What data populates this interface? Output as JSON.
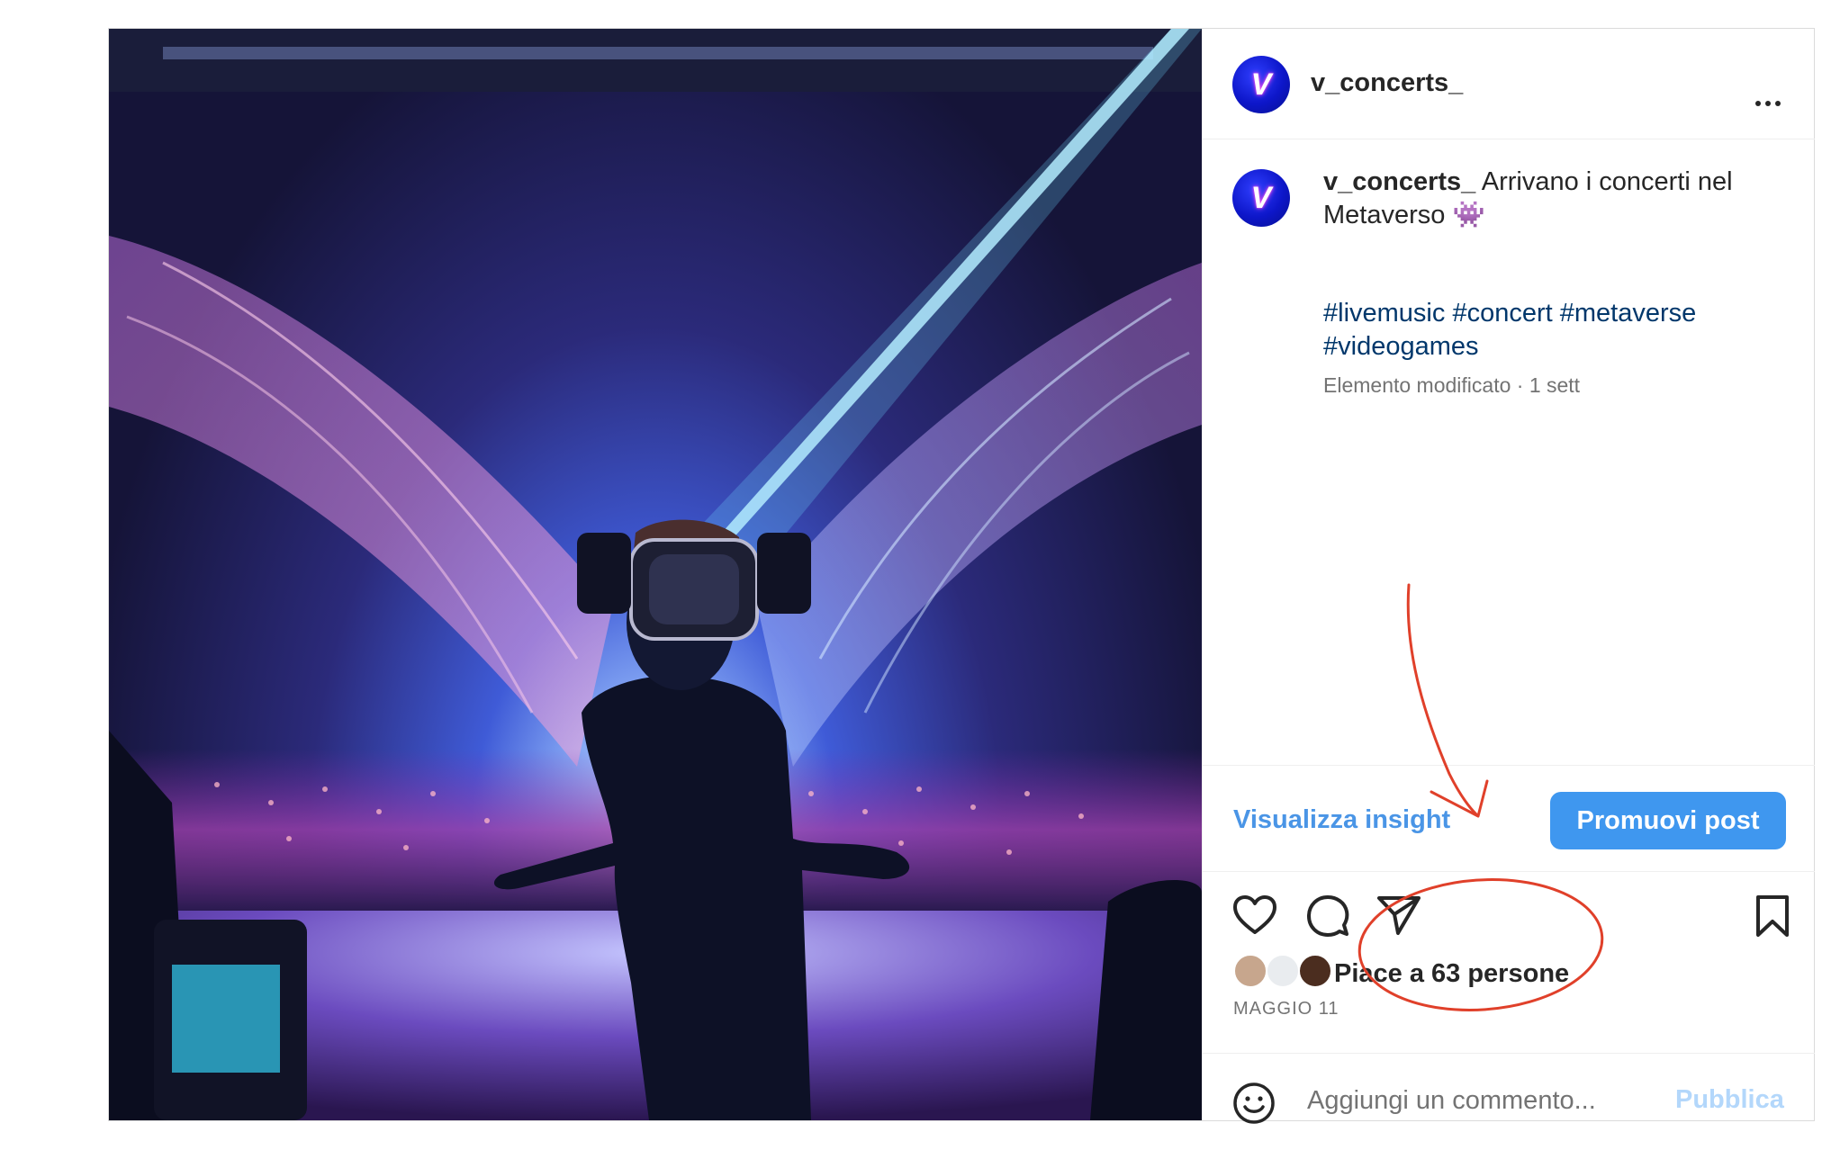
{
  "post": {
    "username": "v_concerts_",
    "avatar_letter": "V",
    "more_icon": "more-horizontal-icon",
    "caption": {
      "username": "v_concerts_",
      "text": "Arrivano i concerti nel Metaverso",
      "emoji": "👾"
    },
    "hashtags": [
      "#livemusic",
      "#concert",
      "#metaverse",
      "#videogames"
    ],
    "meta": "Elemento modificato · 1 sett",
    "insights_link": "Visualizza insight",
    "promote_button": "Promuovi post",
    "actions": {
      "like_icon": "heart-icon",
      "comment_icon": "comment-icon",
      "share_icon": "send-icon",
      "save_icon": "bookmark-icon"
    },
    "likes": "Piace a 63 persone",
    "date": "MAGGIO 11",
    "comment": {
      "emoji_icon": "smiley-icon",
      "placeholder": "Aggiungi un commento...",
      "value": "",
      "publish_label": "Pubblica"
    }
  },
  "colors": {
    "link_blue": "#00376b",
    "button_blue": "#3f97ef",
    "annotation_red": "#e0402a"
  }
}
